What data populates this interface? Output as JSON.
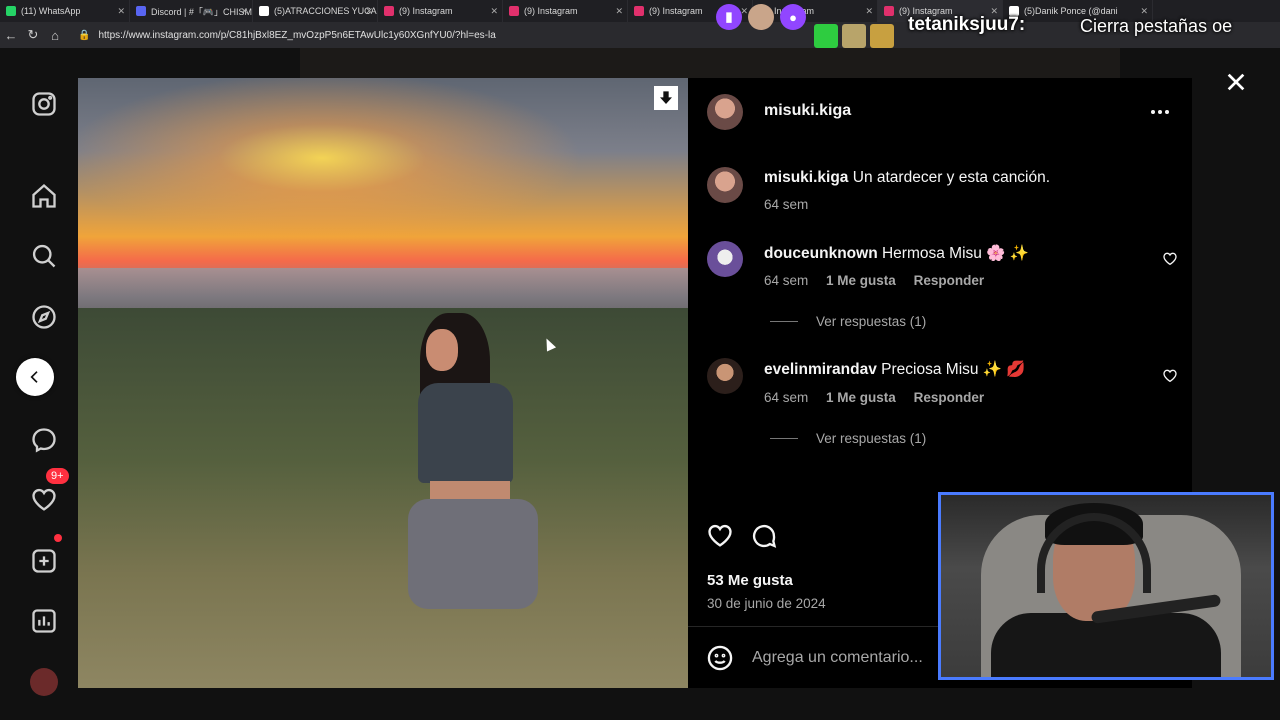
{
  "browser": {
    "tabs": [
      {
        "label": "(11) WhatsApp",
        "color": "#25d366"
      },
      {
        "label": "Discord | #「🎮」CHISM",
        "color": "#5865f2"
      },
      {
        "label": "(5)ATRACCIONES YUCA",
        "color": "#ffffff"
      },
      {
        "label": "(9) Instagram",
        "color": "#e1306c"
      },
      {
        "label": "(9) Instagram",
        "color": "#e1306c"
      },
      {
        "label": "(9) Instagram",
        "color": "#e1306c"
      },
      {
        "label": "Instagram",
        "color": "#e1306c"
      },
      {
        "label": "(9) Instagram",
        "color": "#e1306c"
      },
      {
        "label": "(5)Danik Ponce (@dani",
        "color": "#ffffff"
      }
    ],
    "url": "https://www.instagram.com/p/C81hjBxl8EZ_mvOzpP5n6ETAwUlc1y60XGnfYU0/?hl=es-la"
  },
  "stream": {
    "username": "tetaniksjuu7:",
    "message": "Cierra pestañas oe",
    "accent": "#9146ff"
  },
  "sidebar": {
    "badge": "9+"
  },
  "post": {
    "author": "misuki.kiga",
    "caption_user": "misuki.kiga",
    "caption_text": "Un atardecer y esta canción.",
    "caption_time": "64 sem",
    "comments": [
      {
        "user": "douceunknown",
        "text": "Hermosa Misu 🌸 ✨",
        "time": "64 sem",
        "likes": "1 Me gusta",
        "reply": "Responder",
        "view_replies": "Ver respuestas (1)"
      },
      {
        "user": "evelinmirandav",
        "text": "Preciosa Misu ✨ 💋",
        "time": "64 sem",
        "likes": "1 Me gusta",
        "reply": "Responder",
        "view_replies": "Ver respuestas (1)"
      }
    ],
    "likes": "53 Me gusta",
    "date": "30 de junio de 2024",
    "comment_placeholder": "Agrega un comentario..."
  }
}
